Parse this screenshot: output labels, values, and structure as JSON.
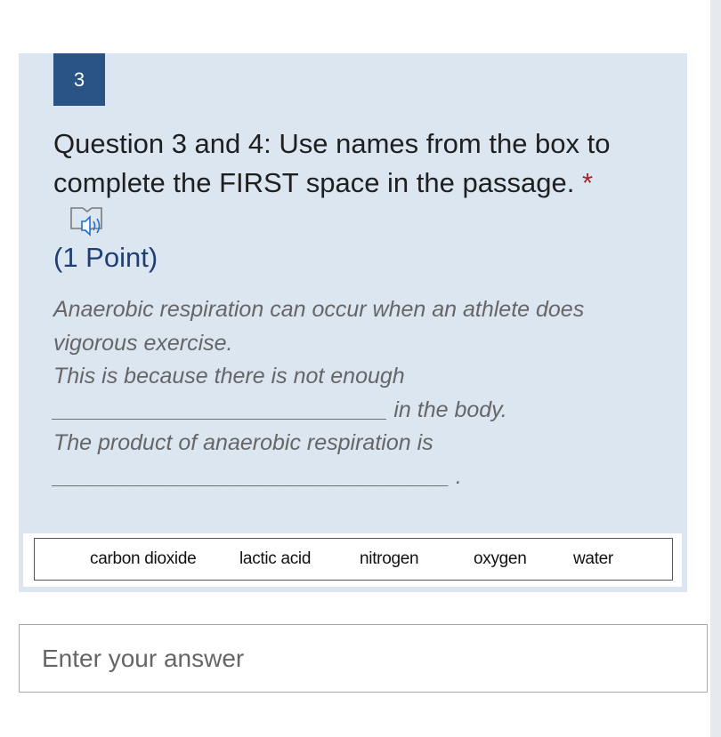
{
  "question": {
    "number": "3",
    "title": "Question 3 and 4: Use names from the box to complete the FIRST space in the passage.",
    "required_mark": "*",
    "points": "(1 Point)",
    "passage_lines": [
      "Anaerobic respiration can occur when an athlete does",
      "vigorous exercise.",
      "This is because there is not enough",
      "___________________________ in the body.",
      "The product of anaerobic respiration is",
      "________________________________ ."
    ],
    "word_box": [
      "carbon dioxide",
      "lactic acid",
      "nitrogen",
      "oxygen",
      "water"
    ]
  },
  "icons": {
    "immersive_reader": "speaker-icon"
  },
  "answer": {
    "placeholder": "Enter your answer",
    "value": ""
  }
}
